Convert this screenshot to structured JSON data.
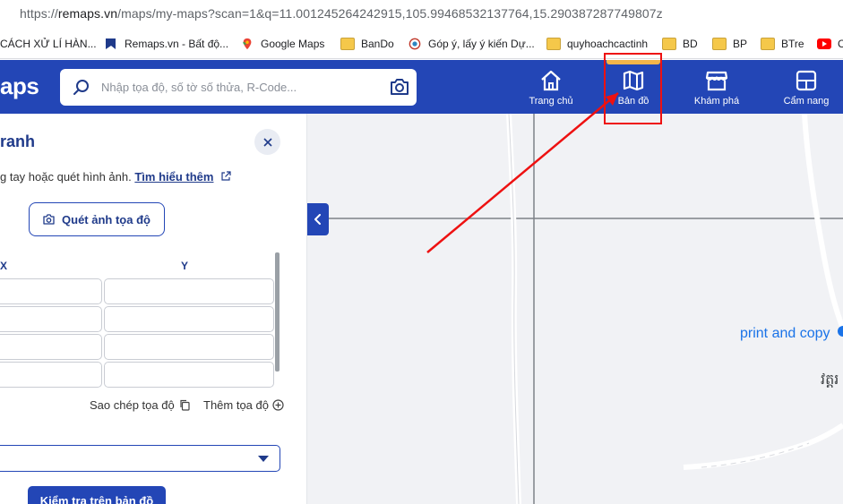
{
  "browser": {
    "url_prefix": "https://",
    "url_host": "remaps.vn",
    "url_rest": "/maps/my-maps?scan=1&q=11.001245264242915,105.99468532137764,15.290387287749807z",
    "bookmarks": [
      {
        "label": "CÁCH XỬ LÍ HÀN...",
        "icon": "document-icon"
      },
      {
        "label": "Remaps.vn - Bất độ...",
        "icon": "remaps-logo-icon"
      },
      {
        "label": "Google Maps",
        "icon": "google-maps-icon"
      },
      {
        "label": "BanDo",
        "icon": "folder-icon"
      },
      {
        "label": "Góp ý, lấy ý kiến Dự...",
        "icon": "site-icon"
      },
      {
        "label": "quyhoachcactinh",
        "icon": "folder-icon"
      },
      {
        "label": "BD",
        "icon": "folder-icon"
      },
      {
        "label": "BP",
        "icon": "folder-icon"
      },
      {
        "label": "BTre",
        "icon": "folder-icon"
      },
      {
        "label": "C",
        "icon": "youtube-icon"
      }
    ]
  },
  "header": {
    "logo": "aps",
    "search_placeholder": "Nhập tọa độ, số tờ số thửa, R-Code...",
    "nav": [
      {
        "label": "Trang chủ",
        "icon": "home-icon"
      },
      {
        "label": "Bản đồ",
        "icon": "map-icon",
        "active": true
      },
      {
        "label": "Khám phá",
        "icon": "store-icon"
      },
      {
        "label": "Cẩm nang",
        "icon": "handbook-icon"
      }
    ],
    "accent_color": "#2346b6",
    "active_indicator_color": "#f3b54a"
  },
  "panel": {
    "title": "ranh",
    "hint_text": "g tay hoặc quét hình ảnh. ",
    "hint_link": "Tìm hiểu thêm",
    "scan_button": "Quét ảnh tọa độ",
    "col_x": "X",
    "col_y": "Y",
    "copy_label": "Sao chép tọa độ",
    "add_label": "Thêm tọa độ",
    "check_button": "Kiểm tra trên bản đồ"
  },
  "map": {
    "poi_label": "print and copy",
    "khmer_label": "វត្តរ"
  },
  "annotation": {
    "color": "#ee1111"
  }
}
